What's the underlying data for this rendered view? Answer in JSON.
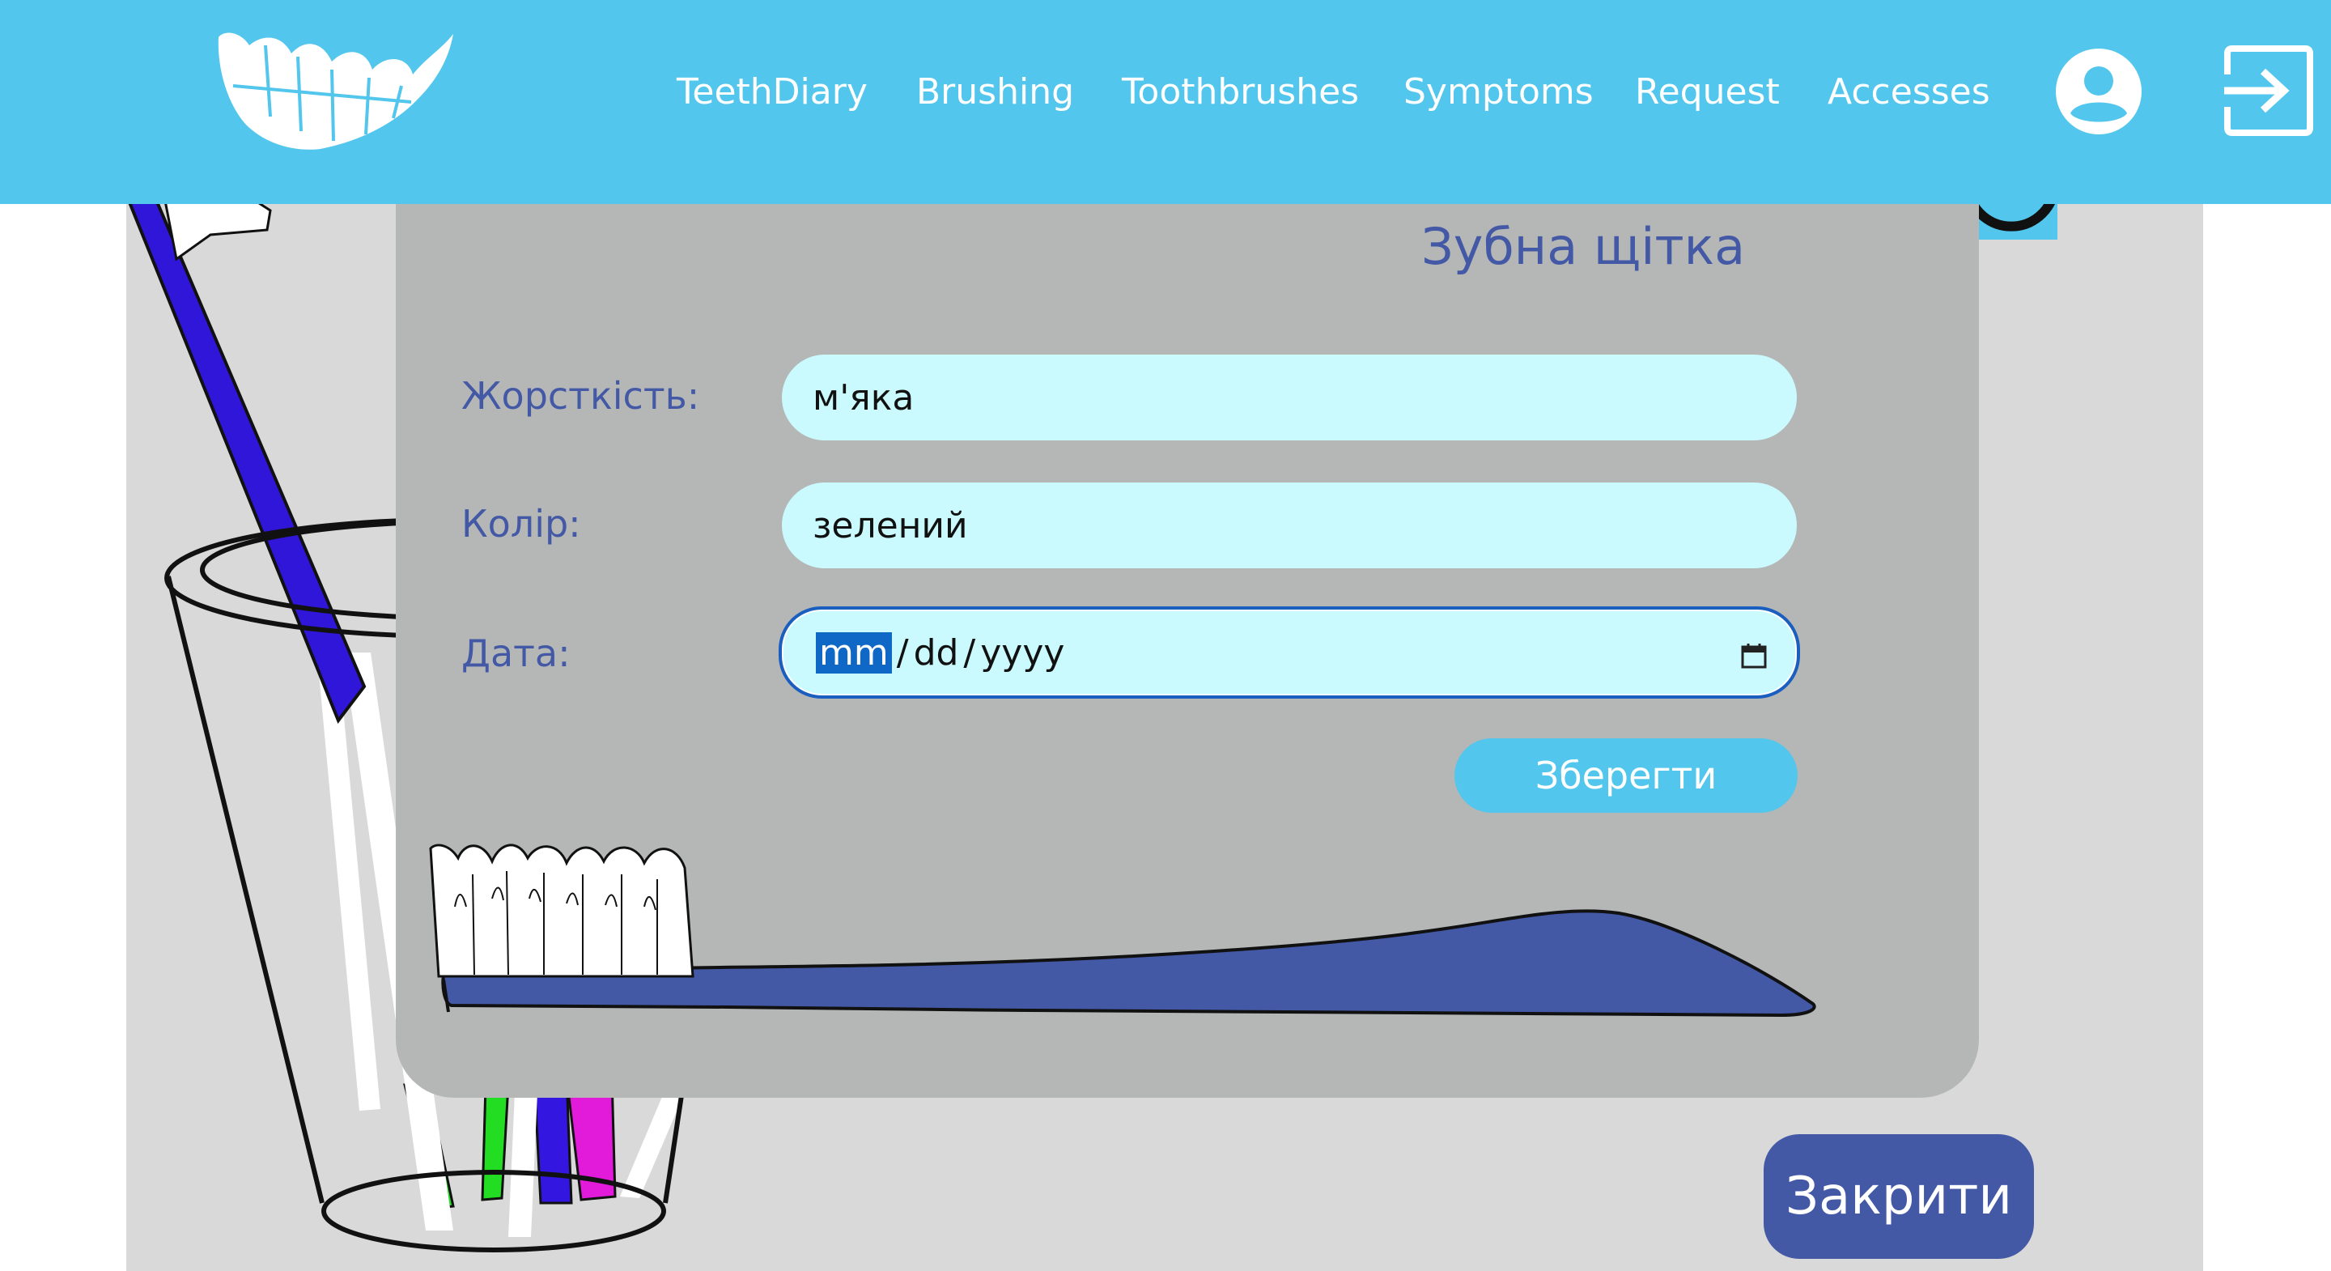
{
  "header": {
    "nav_items": [
      {
        "label": "TeethDiary"
      },
      {
        "label": "Brushing"
      },
      {
        "label": "Toothbrushes"
      },
      {
        "label": "Symptoms"
      },
      {
        "label": "Request"
      },
      {
        "label": "Accesses"
      }
    ],
    "icons": [
      "logo-teeth-icon",
      "user-icon",
      "logout-icon"
    ],
    "background_color": "#52c6ec"
  },
  "modal": {
    "title": "Зубна щітка",
    "fields": [
      {
        "label": "Жорсткість:",
        "value": "м'яка"
      },
      {
        "label": "Колір:",
        "value": "зелений"
      },
      {
        "label": "Дата:",
        "month_placeholder": "mm",
        "day_placeholder": "dd",
        "year_placeholder": "yyyy",
        "separator": "/"
      }
    ],
    "save_label": "Зберегти",
    "accent_color": "#4459a6",
    "field_color": "#cafafd"
  },
  "close_label": "Закрити"
}
